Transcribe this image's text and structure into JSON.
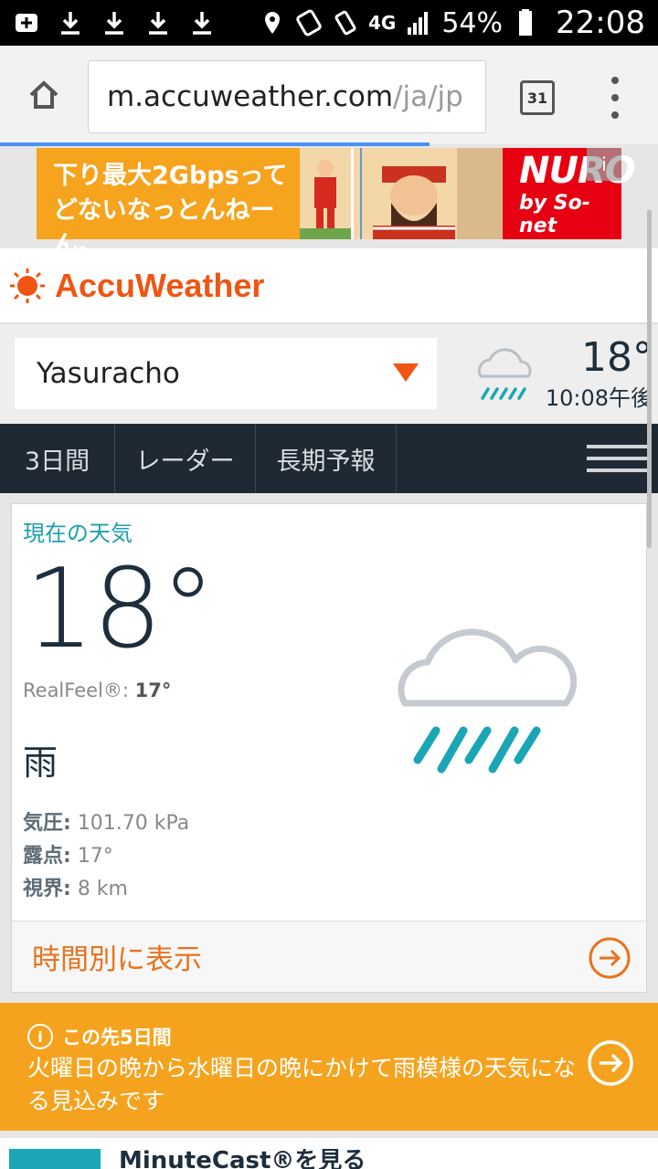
{
  "status_bar": {
    "battery": "54%",
    "time": "22:08",
    "network": "4G"
  },
  "browser": {
    "url_domain": "m.accuweather.com",
    "url_path": "/ja/jp",
    "tabs_count": "31"
  },
  "ad": {
    "line1": "下り最大2Gbpsって",
    "line2": "どないなっとんねーん。",
    "brand": "NURO",
    "brand_sub": "by So-net"
  },
  "header": {
    "logo": "AccuWeather"
  },
  "location": {
    "name": "Yasuracho",
    "temp": "18°",
    "time": "10:08午後"
  },
  "nav": {
    "tabs": [
      {
        "label": "3日間"
      },
      {
        "label": "レーダー"
      },
      {
        "label": "長期予報"
      }
    ]
  },
  "current": {
    "title": "現在の天気",
    "temp": "18°",
    "realfeel_label": "RealFeel®:",
    "realfeel_value": "17°",
    "condition": "雨",
    "pressure_label": "気圧:",
    "pressure_value": "101.70 kPa",
    "dew_label": "露点:",
    "dew_value": "17°",
    "visibility_label": "視界:",
    "visibility_value": "8 km",
    "hourly_link": "時間別に表示"
  },
  "forecast_banner": {
    "title": "この先5日間",
    "text": "火曜日の晩から水曜日の晩にかけて雨模様の天気になる見込みです"
  },
  "bottom": {
    "text": "MinuteCast®を見る"
  },
  "colors": {
    "accent_orange": "#f05514",
    "teal": "#1c9fb0",
    "banner": "#f5a31e",
    "nav_bg": "#1f2933"
  }
}
